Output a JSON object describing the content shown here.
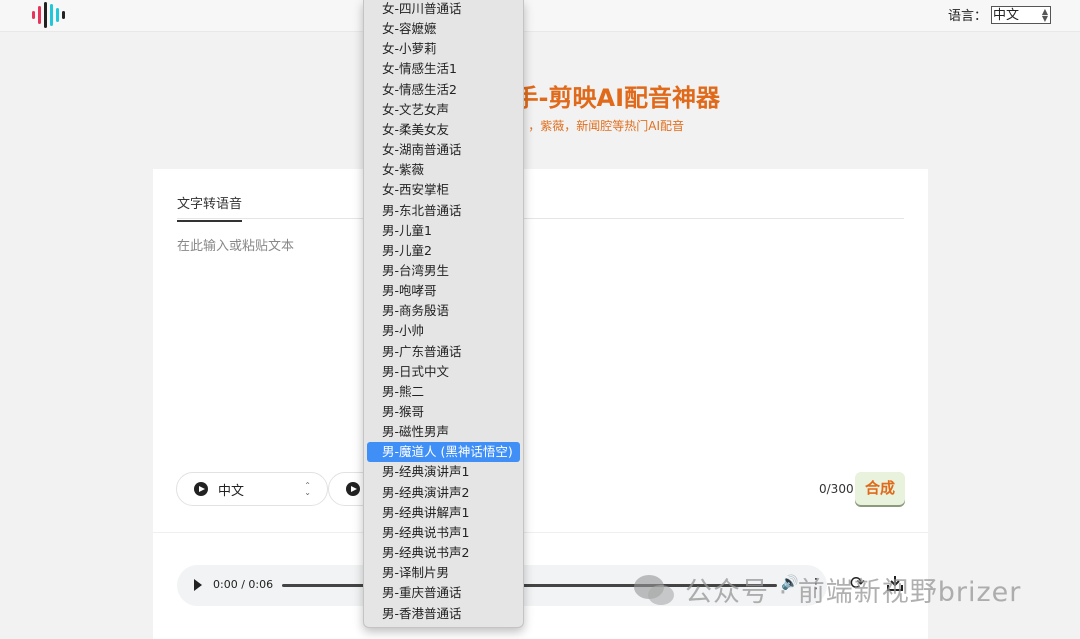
{
  "header": {
    "language_label": "语言：",
    "language_value": "中文"
  },
  "main": {
    "title": "手-剪映AI配音神器",
    "subtitle": "，紫薇，新闻腔等热门AI配音"
  },
  "editor": {
    "tab_label": "文字转语音",
    "placeholder": "在此输入或粘贴文本",
    "language_pill": "中文",
    "char_counter": "0/300",
    "synthesize_label": "合成"
  },
  "player": {
    "time": "0:00 / 0:06"
  },
  "watermark": {
    "text": "公众号 · 前端新视野brizer"
  },
  "voice_dropdown": {
    "selected": "男-魔道人 (黑神话悟空)",
    "options": [
      "女-四川普通话",
      "女-容嬷嬷",
      "女-小萝莉",
      "女-情感生活1",
      "女-情感生活2",
      "女-文艺女声",
      "女-柔美女友",
      "女-湖南普通话",
      "女-紫薇",
      "女-西安掌柜",
      "男-东北普通话",
      "男-儿童1",
      "男-儿童2",
      "男-台湾男生",
      "男-咆哮哥",
      "男-商务殷语",
      "男-小帅",
      "男-广东普通话",
      "男-日式中文",
      "男-熊二",
      "男-猴哥",
      "男-磁性男声",
      "男-魔道人 (黑神话悟空)",
      "男-经典演讲声1",
      "男-经典演讲声2",
      "男-经典讲解声1",
      "男-经典说书声1",
      "男-经典说书声2",
      "男-译制片男",
      "男-重庆普通话",
      "男-香港普通话"
    ]
  },
  "colors": {
    "accent": "#e06a1a",
    "selection": "#3f8ff7",
    "synth_button_bg": "#e9f2dc"
  },
  "icons": {
    "logo": "audio-bars-logo",
    "play": "play-icon",
    "volume": "volume-icon",
    "more": "more-icon",
    "refresh": "refresh-icon",
    "download": "download-icon"
  }
}
